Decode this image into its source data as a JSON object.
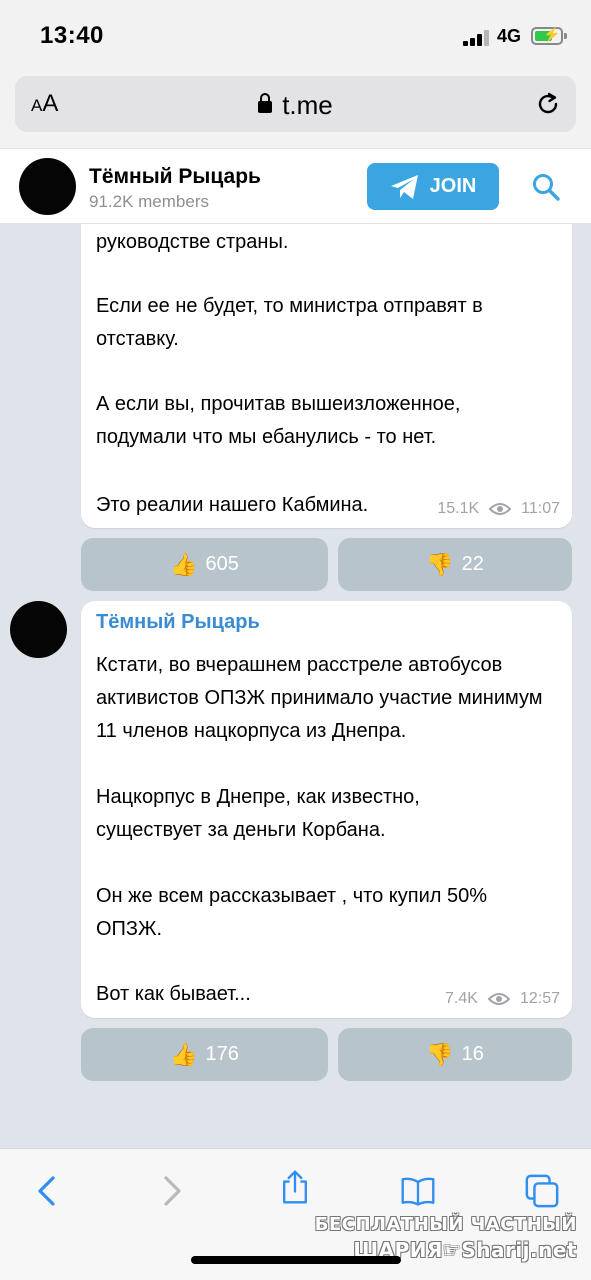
{
  "status_bar": {
    "time": "13:40",
    "network": "4G",
    "battery_level": 0.7
  },
  "browser": {
    "text_size_button": "AA",
    "url": "t.me"
  },
  "channel": {
    "name": "Тёмный Рыцарь",
    "members": "91.2K members",
    "join_label": "JOIN"
  },
  "messages": [
    {
      "paragraphs": [
        "руководстве страны.",
        "Если ее не будет, то министра отправят в отставку.",
        "А если вы, прочитав вышеизложенное, подумали что мы ебанулись - то нет.",
        "Это реалии нашего Кабмина."
      ],
      "views": "15.1K",
      "time": "11:07",
      "likes": "605",
      "dislikes": "22"
    },
    {
      "sender": "Тёмный Рыцарь",
      "paragraphs": [
        "Кстати, во вчерашнем расстреле автобусов активистов ОПЗЖ принимало участие минимум 11 членов нацкорпуса из Днепра.",
        "Нацкорпус в Днепре, как известно, существует за деньги Корбана.",
        "Он же всем рассказывает , что купил 50% ОПЗЖ.",
        "Вот как бывает..."
      ],
      "views": "7.4K",
      "time": "12:57",
      "likes": "176",
      "dislikes": "16"
    }
  ],
  "reactions": {
    "like_emoji": "👍",
    "dislike_emoji": "👎"
  },
  "watermark": {
    "line1": "БЕСПЛАТНЫЙ ЧАСТНЫЙ",
    "line2": "ШАРИЯ☞Sharij.net"
  },
  "colors": {
    "accent": "#3ba5e2",
    "sender": "#3a8bd1",
    "reaction_bg": "#b8c4cc",
    "chat_bg": "#dfe4ea"
  },
  "icons": {
    "back": "chevron-left-icon",
    "forward": "chevron-right-icon",
    "share": "share-icon",
    "bookmarks": "book-icon",
    "tabs": "tabs-icon"
  }
}
